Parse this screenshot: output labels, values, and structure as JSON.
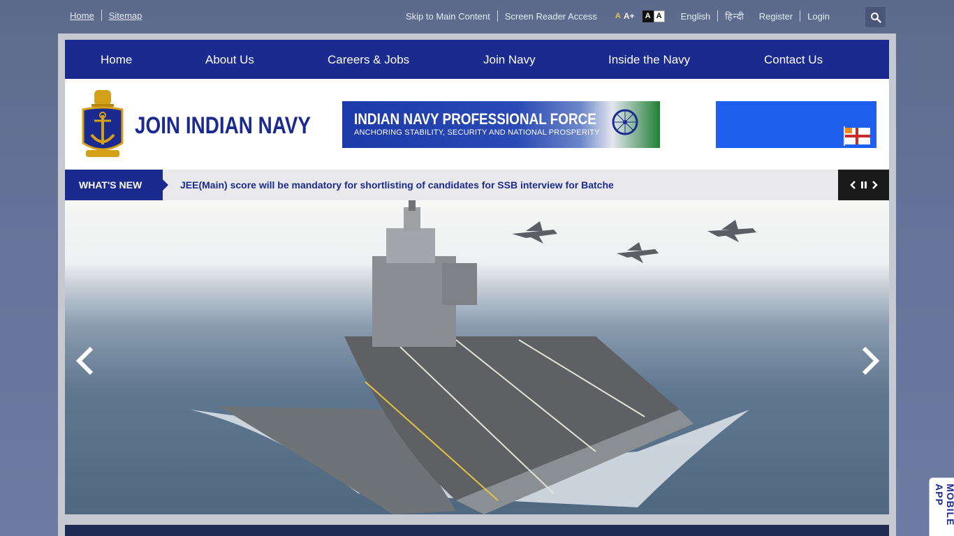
{
  "topbar": {
    "home": "Home",
    "sitemap": "Sitemap",
    "skip": "Skip to Main Content",
    "screen_reader": "Screen Reader Access",
    "font_small": "A",
    "font_large": "A+",
    "contrast_dark": "A",
    "contrast_light": "A",
    "english": "English",
    "hindi": "हिन्दी",
    "register": "Register",
    "login": "Login"
  },
  "nav": {
    "items": [
      "Home",
      "About Us",
      "Careers & Jobs",
      "Join Navy",
      "Inside the Navy",
      "Contact Us"
    ]
  },
  "header": {
    "logo_title": "JOIN INDIAN NAVY",
    "banner_title": "INDIAN NAVY PROFESSIONAL FORCE",
    "banner_subtitle": "ANCHORING STABILITY, SECURITY AND NATIONAL PROSPERITY"
  },
  "ticker": {
    "label": "WHAT'S NEW",
    "text": "JEE(Main) score will be mandatory for shortlisting of candidates for SSB interview for Batche_"
  },
  "mobile_tab": "MOBILE APP",
  "colors": {
    "navy": "#1b2a8f",
    "background": "#65739a"
  }
}
